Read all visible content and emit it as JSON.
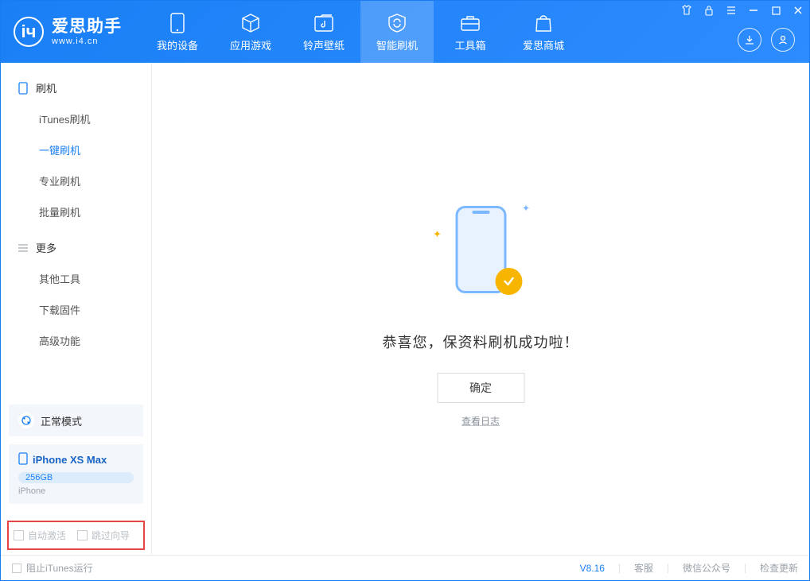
{
  "app": {
    "title": "爱思助手",
    "subtitle": "www.i4.cn"
  },
  "nav": {
    "items": [
      {
        "label": "我的设备"
      },
      {
        "label": "应用游戏"
      },
      {
        "label": "铃声壁纸"
      },
      {
        "label": "智能刷机"
      },
      {
        "label": "工具箱"
      },
      {
        "label": "爱思商城"
      }
    ]
  },
  "sidebar": {
    "group1_title": "刷机",
    "group1_items": [
      "iTunes刷机",
      "一键刷机",
      "专业刷机",
      "批量刷机"
    ],
    "group2_title": "更多",
    "group2_items": [
      "其他工具",
      "下载固件",
      "高级功能"
    ],
    "mode_label": "正常模式",
    "device_name": "iPhone XS Max",
    "device_capacity": "256GB",
    "device_type": "iPhone",
    "chk1": "自动激活",
    "chk2": "跳过向导"
  },
  "main": {
    "success_title": "恭喜您，保资料刷机成功啦！",
    "ok": "确定",
    "view_log": "查看日志"
  },
  "footer": {
    "block_itunes": "阻止iTunes运行",
    "version": "V8.16",
    "links": [
      "客服",
      "微信公众号",
      "检查更新"
    ]
  }
}
